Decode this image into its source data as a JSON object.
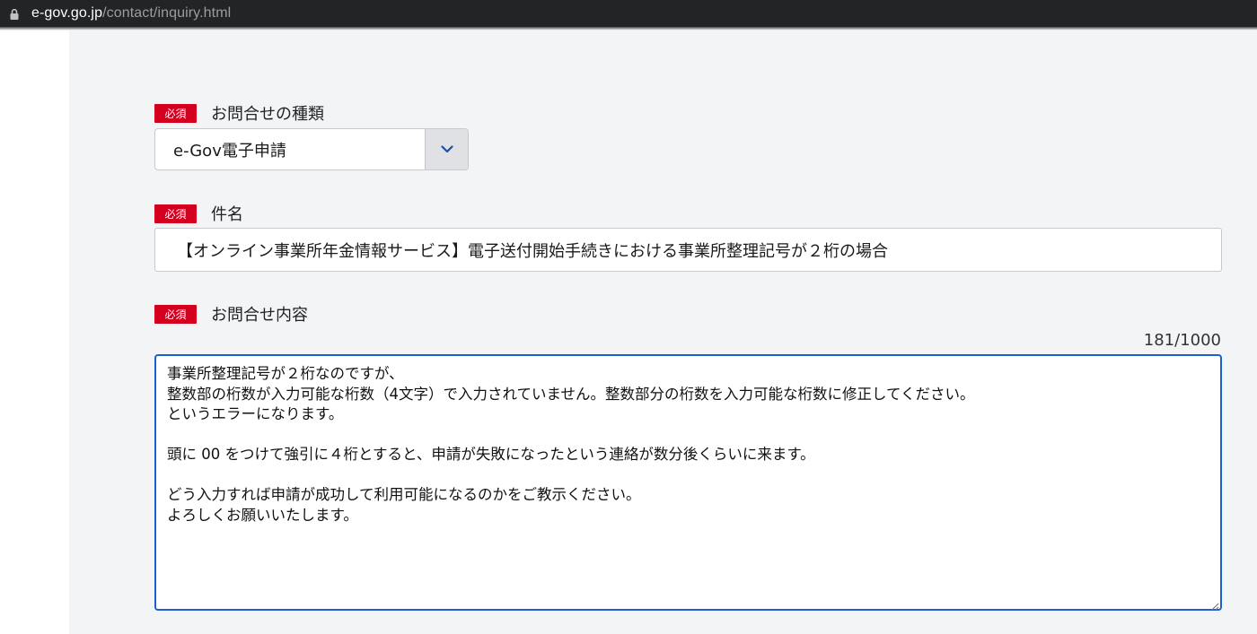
{
  "browser": {
    "url_host": "e-gov.go.jp",
    "url_path": "/contact/inquiry.html"
  },
  "form": {
    "required_badge": "必須",
    "inquiry_type": {
      "label": "お問合せの種類",
      "selected": "e-Gov電子申請"
    },
    "subject": {
      "label": "件名",
      "value": "【オンライン事業所年金情報サービス】電子送付開始手続きにおける事業所整理記号が２桁の場合"
    },
    "content": {
      "label": "お問合せ内容",
      "counter": "181/1000",
      "value": "事業所整理記号が２桁なのですが、\n整数部の桁数が入力可能な桁数（4文字）で入力されていません。整数部分の桁数を入力可能な桁数に修正してください。\nというエラーになります。\n\n頭に 00 をつけて強引に４桁とすると、申請が失敗になったという連絡が数分後くらいに来ます。\n\nどう入力すれば申請が成功して利用可能になるのかをご教示ください。\nよろしくお願いいたします。"
    }
  },
  "colors": {
    "required_badge": "#d5001f",
    "focus_border": "#1b5fd1",
    "panel_bg": "#f3f4f6"
  },
  "icons": {
    "lock": "lock-icon",
    "dropdown": "chevron-down-icon",
    "resize": "resize-grip-icon"
  }
}
